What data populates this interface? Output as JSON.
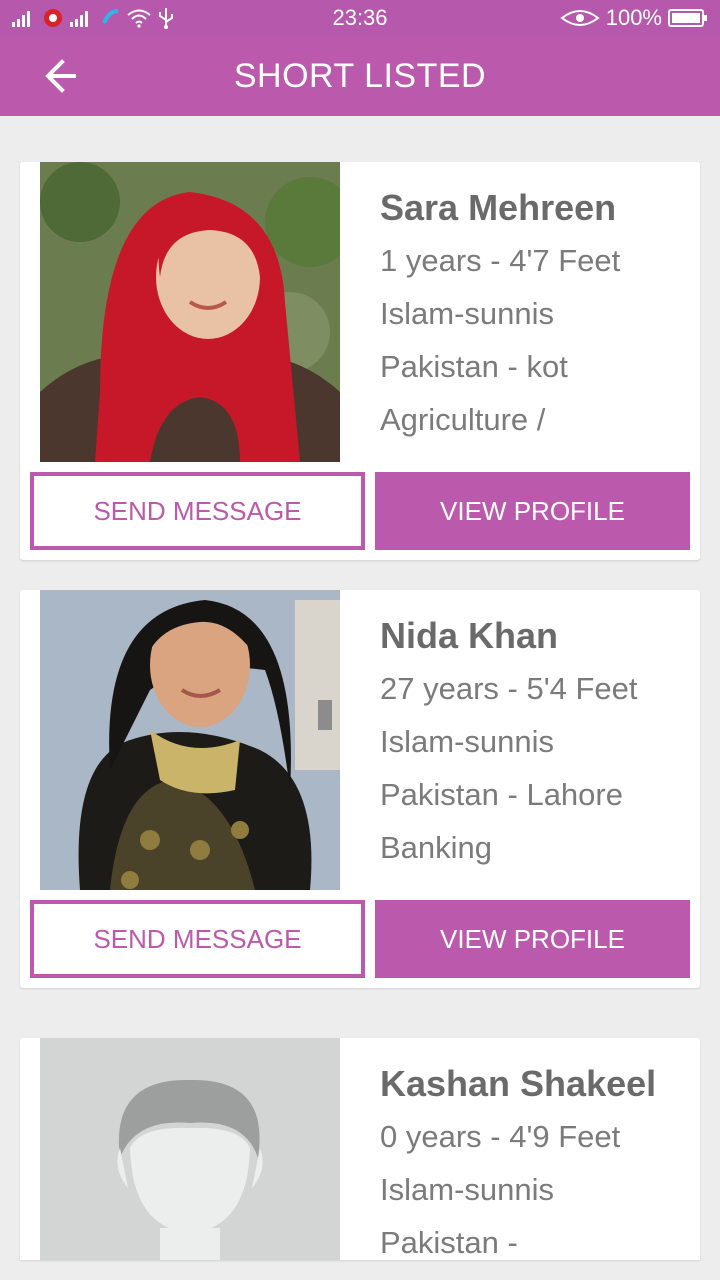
{
  "status_bar": {
    "time": "23:36",
    "battery": "100%",
    "icons": [
      "signal-icon",
      "signal-icon",
      "wifi-icon",
      "usb-icon",
      "eye-icon",
      "battery-icon"
    ]
  },
  "app_bar": {
    "title": "SHORT LISTED",
    "back_icon": "arrow-left-icon"
  },
  "colors": {
    "accent": "#bb59ad",
    "background": "#ededed",
    "card": "#ffffff",
    "text": "#7b7b7b"
  },
  "profiles": [
    {
      "name": "Sara Mehreen",
      "age_height": "1 years - 4'7 Feet",
      "religion": "Islam-sunnis",
      "location": "Pakistan - kot",
      "profession": "Agriculture /",
      "send_label": "SEND MESSAGE",
      "view_label": "VIEW PROFILE"
    },
    {
      "name": "Nida Khan",
      "age_height": "27 years - 5'4 Feet",
      "religion": "Islam-sunnis",
      "location": "Pakistan - Lahore",
      "profession": "Banking",
      "send_label": "SEND MESSAGE",
      "view_label": "VIEW PROFILE"
    },
    {
      "name": "Kashan Shakeel",
      "age_height": "0 years - 4'9 Feet",
      "religion": "Islam-sunnis",
      "location": "Pakistan -",
      "profession": "",
      "send_label": "",
      "view_label": ""
    }
  ]
}
